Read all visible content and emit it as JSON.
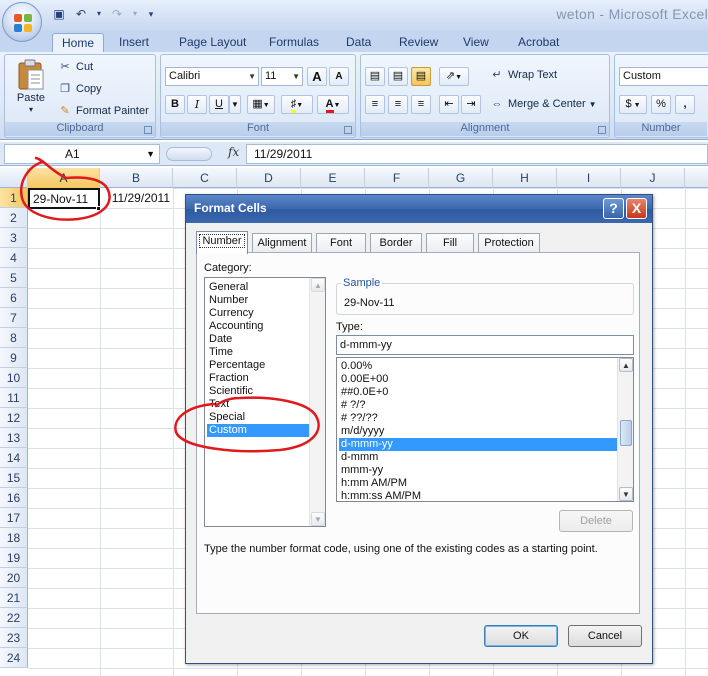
{
  "window": {
    "title": "weton - Microsoft Excel",
    "quick_access": [
      "save-icon",
      "undo-icon",
      "redo-icon",
      "customize-icon"
    ]
  },
  "ribbon": {
    "tabs": [
      "Home",
      "Insert",
      "Page Layout",
      "Formulas",
      "Data",
      "Review",
      "View",
      "Acrobat"
    ],
    "active_tab": "Home",
    "clipboard": {
      "label": "Clipboard",
      "paste": "Paste",
      "cut": "Cut",
      "copy": "Copy",
      "format_painter": "Format Painter"
    },
    "font": {
      "label": "Font",
      "name": "Calibri",
      "size": "11",
      "bold": "B",
      "italic": "I",
      "underline": "U",
      "grow": "A",
      "shrink": "A"
    },
    "alignment": {
      "label": "Alignment",
      "wrap_text": "Wrap Text",
      "merge_center": "Merge & Center"
    },
    "number": {
      "label": "Number",
      "format": "Custom",
      "currency": "$",
      "percent": "%",
      "comma": ","
    }
  },
  "formula_bar": {
    "name_box": "A1",
    "fx": "fx",
    "value": "11/29/2011"
  },
  "sheet": {
    "columns": [
      "A",
      "B",
      "C",
      "D",
      "E",
      "F",
      "G",
      "H",
      "I",
      "J"
    ],
    "active_column": "A",
    "rows": [
      "1",
      "2",
      "3",
      "4",
      "5",
      "6",
      "7",
      "8",
      "9",
      "10",
      "11",
      "12",
      "13",
      "14",
      "15",
      "16",
      "17",
      "18",
      "19",
      "20",
      "21",
      "22",
      "23",
      "24"
    ],
    "active_row": "1",
    "cells": {
      "A1": "29-Nov-11",
      "B1": "11/29/2011"
    }
  },
  "dialog": {
    "title": "Format Cells",
    "help": "?",
    "close": "X",
    "tabs": [
      "Number",
      "Alignment",
      "Font",
      "Border",
      "Fill",
      "Protection"
    ],
    "active_tab": "Number",
    "category_label": "Category:",
    "categories": [
      "General",
      "Number",
      "Currency",
      "Accounting",
      "Date",
      "Time",
      "Percentage",
      "Fraction",
      "Scientific",
      "Text",
      "Special",
      "Custom"
    ],
    "selected_category": "Custom",
    "sample_label": "Sample",
    "sample_value": "29-Nov-11",
    "type_label": "Type:",
    "type_value": "d-mmm-yy",
    "types": [
      "0.00%",
      "0.00E+00",
      "##0.0E+0",
      "# ?/?",
      "# ??/??",
      "m/d/yyyy",
      "d-mmm-yy",
      "d-mmm",
      "mmm-yy",
      "h:mm AM/PM",
      "h:mm:ss AM/PM"
    ],
    "selected_type": "d-mmm-yy",
    "delete_button": "Delete",
    "hint": "Type the number format code, using one of the existing codes as a starting point.",
    "ok_button": "OK",
    "cancel_button": "Cancel"
  },
  "colors": {
    "annotation": "#e0191d",
    "selection": "#3399ff",
    "active_header": "#f5c65f"
  }
}
